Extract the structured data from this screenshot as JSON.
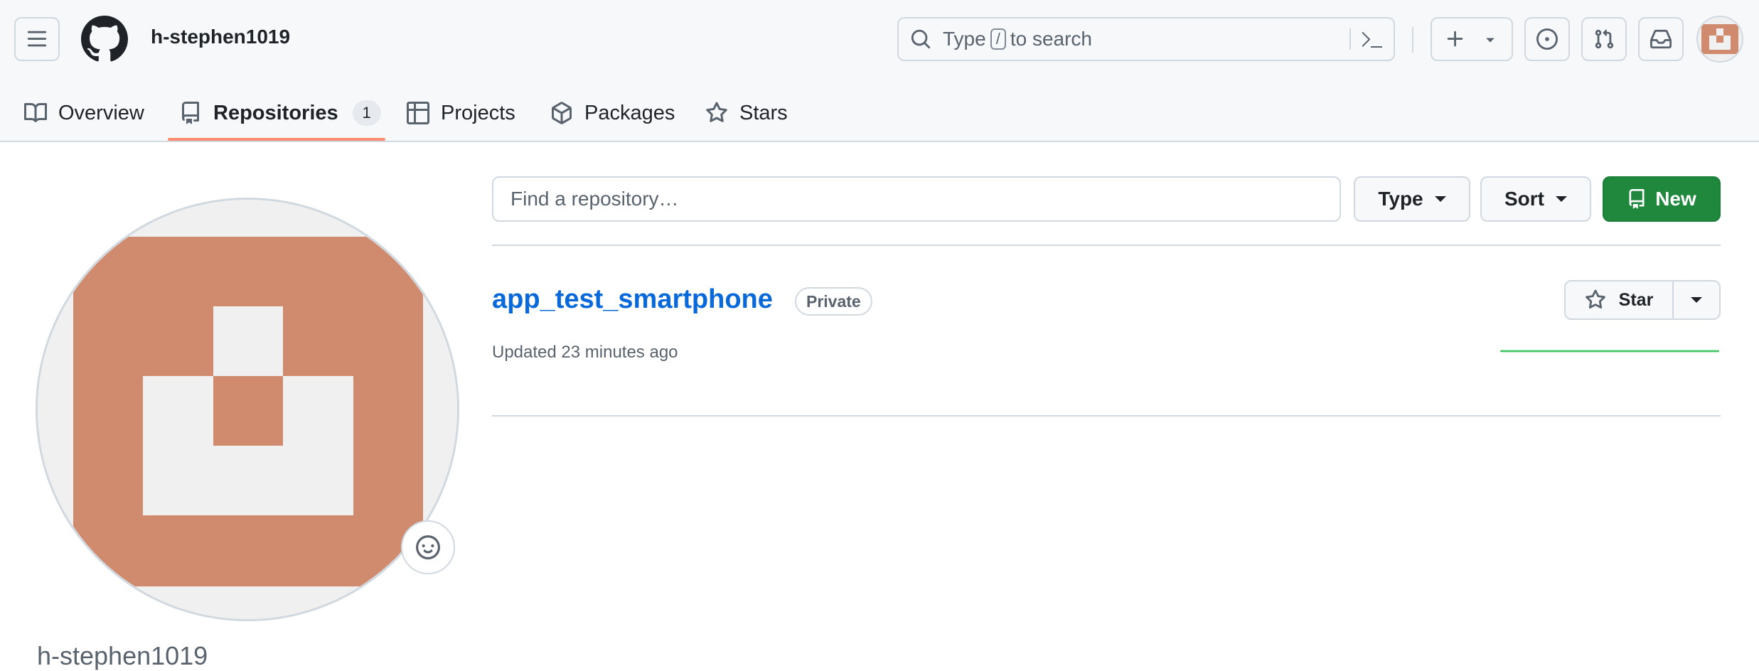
{
  "header": {
    "username": "h-stephen1019",
    "search": {
      "prefix": "Type",
      "key": "/",
      "suffix": "to search"
    }
  },
  "tabs": [
    {
      "label": "Overview",
      "icon": "book-icon"
    },
    {
      "label": "Repositories",
      "icon": "repo-icon",
      "count": "1",
      "selected": true
    },
    {
      "label": "Projects",
      "icon": "table-icon"
    },
    {
      "label": "Packages",
      "icon": "package-icon"
    },
    {
      "label": "Stars",
      "icon": "star-icon"
    }
  ],
  "profile": {
    "name": "h-stephen1019",
    "avatar_color": "#d08b6e"
  },
  "repo_list": {
    "find_placeholder": "Find a repository…",
    "type_label": "Type",
    "sort_label": "Sort",
    "new_label": "New",
    "repos": [
      {
        "name": "app_test_smartphone",
        "visibility": "Private",
        "updated": "Updated 23 minutes ago",
        "star_label": "Star"
      }
    ]
  },
  "colors": {
    "accent_underline": "#fd8c73",
    "new_button": "#1f883d",
    "link": "#0969da"
  }
}
